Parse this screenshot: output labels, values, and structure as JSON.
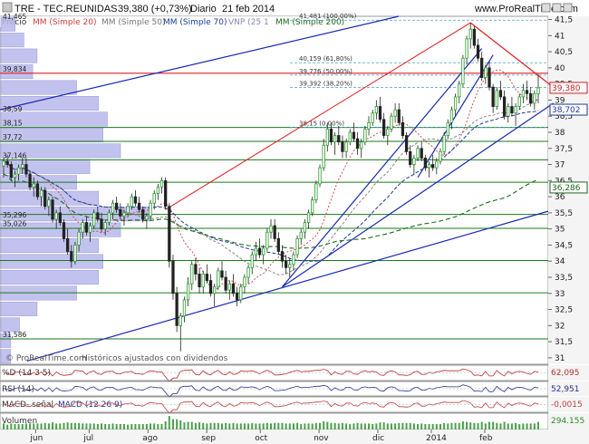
{
  "header": {
    "title": "TRE - TEC.REUNIDAS",
    "price": "39,380 (+0,73%)",
    "period": "Diario",
    "date": "21 feb 2014",
    "site": "www.ProRealTime.com"
  },
  "legend": {
    "price": "Precio",
    "ma20": "MM (Simple 20)",
    "ma50": "MM (Simple 50)",
    "ma70": "MM (Simple 70)",
    "vwap": "VNP (25 1",
    "ma200": "MM (Simple 200)"
  },
  "colors": {
    "candle_up": "#2a9a2a",
    "candle_down": "#222222",
    "ma20": "#c84040",
    "ma50": "#7a7a7a",
    "ma70": "#1e3a9a",
    "ma200": "#1a6a1a",
    "trend_blue": "#1a2ab4",
    "trend_red": "#e02020",
    "volume_profile": "#b8b8ec"
  },
  "chart_data": {
    "type": "candlestick",
    "y_range": [
      30.8,
      41.6
    ],
    "y_ticks": [
      "41,5",
      "41",
      "40,5",
      "40",
      "39,5",
      "39",
      "38,5",
      "38",
      "37,5",
      "37",
      "36,5",
      "36",
      "35,5",
      "35",
      "34,5",
      "34",
      "33,5",
      "33",
      "32,5",
      "32",
      "31,5",
      "31"
    ],
    "x_labels": [
      "jun",
      "jul",
      "ago",
      "sep",
      "oct",
      "nov",
      "dic",
      "2014",
      "feb"
    ],
    "last_price": "39,380",
    "price_tags": [
      {
        "label": "39,380",
        "value": 39.38,
        "color": "#c82020"
      },
      {
        "label": "38,702",
        "value": 38.702,
        "color": "#1e3a9a"
      },
      {
        "label": "36,286",
        "value": 36.286,
        "color": "#1a6a1a"
      }
    ],
    "fib_labels": [
      {
        "label": "41,481 (100,00%)",
        "value": 41.481
      },
      {
        "label": "40,159 (61,80%)",
        "value": 40.159
      },
      {
        "label": "39,776 (50,00%)",
        "value": 39.776
      },
      {
        "label": "39,392 (38,20%)",
        "value": 39.392
      },
      {
        "label": "38,15 (0,00%)",
        "value": 38.15
      }
    ],
    "hlevels": [
      {
        "label": "41,465",
        "value": 41.465
      },
      {
        "label": "39,834",
        "value": 39.834
      },
      {
        "label": "38,59",
        "value": 38.59
      },
      {
        "label": "38,15",
        "value": 38.15
      },
      {
        "label": "37,72",
        "value": 37.72
      },
      {
        "label": "37,146",
        "value": 37.146
      },
      {
        "label": "35,296",
        "value": 35.296
      },
      {
        "label": "35,026",
        "value": 35.026
      },
      {
        "label": "31,586",
        "value": 31.586
      }
    ],
    "green_levels": [
      38.15,
      37.72,
      37.146,
      36.45,
      35.45,
      35.02,
      34.02,
      33.02,
      31.586
    ],
    "red_level": 39.834,
    "candles": [
      [
        36.95,
        37.2,
        36.6,
        37.1
      ],
      [
        37.1,
        37.3,
        36.9,
        37.0
      ],
      [
        37.0,
        37.1,
        36.5,
        36.6
      ],
      [
        36.6,
        36.8,
        36.3,
        36.7
      ],
      [
        36.7,
        37.0,
        36.5,
        36.9
      ],
      [
        36.9,
        37.2,
        36.7,
        37.0
      ],
      [
        37.0,
        37.2,
        36.6,
        36.7
      ],
      [
        36.7,
        36.8,
        36.2,
        36.3
      ],
      [
        36.3,
        36.6,
        36.0,
        36.4
      ],
      [
        36.4,
        36.5,
        35.9,
        36.0
      ],
      [
        36.0,
        36.3,
        35.7,
        36.2
      ],
      [
        36.2,
        36.3,
        35.6,
        35.7
      ],
      [
        35.7,
        36.0,
        35.4,
        35.9
      ],
      [
        35.9,
        36.0,
        35.2,
        35.3
      ],
      [
        35.3,
        35.6,
        35.0,
        35.5
      ],
      [
        35.5,
        35.7,
        35.1,
        35.2
      ],
      [
        35.2,
        35.3,
        34.6,
        34.7
      ],
      [
        34.7,
        35.0,
        34.2,
        34.3
      ],
      [
        34.3,
        34.5,
        33.8,
        34.0
      ],
      [
        34.0,
        34.6,
        33.9,
        34.5
      ],
      [
        34.5,
        35.0,
        34.3,
        34.9
      ],
      [
        34.9,
        35.3,
        34.7,
        35.2
      ],
      [
        35.2,
        35.4,
        34.8,
        34.9
      ],
      [
        34.9,
        35.2,
        34.6,
        35.1
      ],
      [
        35.1,
        35.6,
        35.0,
        35.5
      ],
      [
        35.5,
        35.7,
        35.2,
        35.3
      ],
      [
        35.3,
        35.5,
        34.9,
        35.0
      ],
      [
        35.0,
        35.3,
        34.8,
        35.2
      ],
      [
        35.2,
        35.6,
        35.1,
        35.5
      ],
      [
        35.5,
        35.9,
        35.3,
        35.8
      ],
      [
        35.8,
        36.0,
        35.5,
        35.6
      ],
      [
        35.6,
        35.8,
        35.3,
        35.4
      ],
      [
        35.4,
        35.6,
        35.1,
        35.5
      ],
      [
        35.5,
        35.8,
        35.4,
        35.7
      ],
      [
        35.7,
        36.1,
        35.6,
        36.0
      ],
      [
        36.0,
        36.2,
        35.7,
        35.8
      ],
      [
        35.8,
        36.0,
        35.5,
        35.6
      ],
      [
        35.6,
        35.7,
        35.2,
        35.3
      ],
      [
        35.3,
        35.5,
        35.0,
        35.4
      ],
      [
        35.4,
        35.9,
        35.3,
        35.8
      ],
      [
        35.8,
        36.2,
        35.6,
        36.1
      ],
      [
        36.1,
        36.4,
        35.9,
        36.3
      ],
      [
        36.3,
        36.6,
        36.1,
        36.5
      ],
      [
        36.5,
        36.6,
        35.6,
        35.7
      ],
      [
        35.7,
        35.8,
        33.8,
        34.0
      ],
      [
        34.0,
        34.2,
        32.8,
        33.0
      ],
      [
        33.0,
        33.2,
        31.8,
        32.0
      ],
      [
        32.0,
        32.4,
        31.2,
        32.3
      ],
      [
        32.3,
        32.9,
        32.1,
        32.8
      ],
      [
        32.8,
        33.5,
        32.6,
        33.3
      ],
      [
        33.3,
        34.0,
        33.1,
        33.9
      ],
      [
        33.9,
        34.1,
        33.4,
        33.6
      ],
      [
        33.6,
        33.8,
        33.0,
        33.2
      ],
      [
        33.2,
        33.7,
        33.0,
        33.6
      ],
      [
        33.6,
        33.9,
        33.3,
        33.4
      ],
      [
        33.4,
        33.6,
        32.9,
        33.0
      ],
      [
        33.0,
        33.3,
        32.6,
        33.2
      ],
      [
        33.2,
        33.8,
        33.1,
        33.7
      ],
      [
        33.7,
        34.0,
        33.4,
        33.5
      ],
      [
        33.5,
        33.7,
        33.0,
        33.1
      ],
      [
        33.1,
        33.4,
        32.8,
        33.3
      ],
      [
        33.3,
        33.6,
        32.9,
        33.0
      ],
      [
        33.0,
        33.2,
        32.6,
        32.8
      ],
      [
        32.8,
        33.3,
        32.7,
        33.2
      ],
      [
        33.2,
        33.6,
        33.0,
        33.5
      ],
      [
        33.5,
        33.9,
        33.3,
        33.8
      ],
      [
        33.8,
        34.3,
        33.6,
        34.2
      ],
      [
        34.2,
        34.6,
        34.0,
        34.4
      ],
      [
        34.4,
        34.7,
        34.1,
        34.2
      ],
      [
        34.2,
        34.5,
        33.9,
        34.4
      ],
      [
        34.4,
        35.0,
        34.3,
        34.9
      ],
      [
        34.9,
        35.3,
        34.7,
        35.1
      ],
      [
        35.1,
        35.3,
        34.6,
        34.7
      ],
      [
        34.7,
        34.9,
        34.2,
        34.3
      ],
      [
        34.3,
        34.5,
        33.8,
        34.0
      ],
      [
        34.0,
        34.2,
        33.6,
        33.8
      ],
      [
        33.8,
        34.1,
        33.5,
        33.9
      ],
      [
        33.9,
        34.3,
        33.7,
        34.2
      ],
      [
        34.2,
        34.8,
        34.1,
        34.7
      ],
      [
        34.7,
        35.0,
        34.5,
        34.9
      ],
      [
        34.9,
        35.3,
        34.7,
        35.2
      ],
      [
        35.2,
        35.6,
        35.0,
        35.5
      ],
      [
        35.5,
        36.0,
        35.4,
        35.9
      ],
      [
        35.9,
        36.5,
        35.8,
        36.4
      ],
      [
        36.4,
        37.0,
        36.3,
        36.9
      ],
      [
        36.9,
        37.8,
        36.8,
        37.6
      ],
      [
        37.6,
        38.3,
        37.4,
        38.1
      ],
      [
        38.1,
        38.3,
        37.6,
        37.7
      ],
      [
        37.7,
        38.0,
        37.3,
        37.9
      ],
      [
        37.9,
        38.2,
        37.6,
        37.7
      ],
      [
        37.7,
        37.9,
        37.2,
        37.4
      ],
      [
        37.4,
        37.8,
        37.2,
        37.7
      ],
      [
        37.7,
        38.1,
        37.6,
        38.0
      ],
      [
        38.0,
        38.3,
        37.7,
        37.8
      ],
      [
        37.8,
        38.0,
        37.3,
        37.5
      ],
      [
        37.5,
        37.8,
        37.2,
        37.7
      ],
      [
        37.7,
        38.2,
        37.6,
        38.1
      ],
      [
        38.1,
        38.5,
        37.9,
        38.3
      ],
      [
        38.3,
        38.7,
        38.2,
        38.6
      ],
      [
        38.6,
        39.0,
        38.4,
        38.8
      ],
      [
        38.8,
        39.1,
        38.3,
        38.4
      ],
      [
        38.4,
        38.6,
        37.8,
        37.9
      ],
      [
        37.9,
        38.2,
        37.6,
        38.1
      ],
      [
        38.1,
        38.6,
        38.0,
        38.5
      ],
      [
        38.5,
        38.9,
        38.3,
        38.7
      ],
      [
        38.7,
        38.9,
        38.2,
        38.3
      ],
      [
        38.3,
        38.5,
        37.8,
        37.9
      ],
      [
        37.9,
        38.0,
        37.3,
        37.4
      ],
      [
        37.4,
        37.6,
        36.9,
        37.0
      ],
      [
        37.0,
        37.3,
        36.7,
        37.2
      ],
      [
        37.2,
        37.6,
        37.1,
        37.5
      ],
      [
        37.5,
        37.7,
        37.1,
        37.2
      ],
      [
        37.2,
        37.3,
        36.8,
        36.9
      ],
      [
        36.9,
        37.1,
        36.6,
        37.0
      ],
      [
        37.0,
        37.3,
        36.8,
        36.9
      ],
      [
        36.9,
        37.2,
        36.7,
        37.1
      ],
      [
        37.1,
        37.5,
        37.0,
        37.4
      ],
      [
        37.4,
        38.0,
        37.3,
        37.9
      ],
      [
        37.9,
        38.4,
        37.8,
        38.3
      ],
      [
        38.3,
        38.8,
        38.1,
        38.7
      ],
      [
        38.7,
        39.2,
        38.5,
        39.1
      ],
      [
        39.1,
        39.6,
        38.9,
        39.5
      ],
      [
        39.5,
        40.4,
        39.4,
        40.3
      ],
      [
        40.3,
        41.0,
        40.1,
        40.9
      ],
      [
        40.9,
        41.4,
        40.6,
        41.2
      ],
      [
        41.2,
        41.3,
        40.6,
        40.7
      ],
      [
        40.7,
        40.9,
        40.2,
        40.3
      ],
      [
        40.3,
        40.5,
        39.6,
        39.7
      ],
      [
        39.7,
        40.1,
        39.5,
        40.0
      ],
      [
        40.0,
        40.2,
        39.3,
        39.4
      ],
      [
        39.4,
        39.5,
        38.6,
        38.8
      ],
      [
        38.8,
        39.4,
        38.7,
        39.3
      ],
      [
        39.3,
        39.6,
        39.0,
        39.1
      ],
      [
        39.1,
        39.3,
        38.4,
        38.5
      ],
      [
        38.5,
        38.9,
        38.3,
        38.8
      ],
      [
        38.8,
        39.1,
        38.5,
        38.6
      ],
      [
        38.6,
        38.9,
        38.2,
        38.8
      ],
      [
        38.8,
        39.2,
        38.7,
        39.1
      ],
      [
        39.1,
        39.5,
        38.9,
        39.3
      ],
      [
        39.3,
        39.6,
        39.0,
        39.2
      ],
      [
        39.2,
        39.4,
        38.8,
        38.9
      ],
      [
        38.9,
        39.3,
        38.7,
        39.2
      ],
      [
        39.2,
        39.8,
        38.9,
        39.38
      ]
    ]
  },
  "indicators": [
    {
      "name": "%K",
      "label": "%D (14 3 5)",
      "value": "62,095",
      "color": "#b83030"
    },
    {
      "name": "RSI",
      "label": "RSI (14)",
      "value": "52,951",
      "color": "#223388"
    },
    {
      "name": "MACD",
      "label": "MACD- señal",
      "label2": "MACD (12 26 9)",
      "value": "-0,0015",
      "color": "#c04040"
    },
    {
      "name": "Volumen",
      "label": "Volumen",
      "value": "294.155",
      "color": "#2a8a2a"
    }
  ],
  "footer": {
    "watermark": "© ProRealTime.com",
    "note": "Históricos ajustados con dividendos"
  }
}
